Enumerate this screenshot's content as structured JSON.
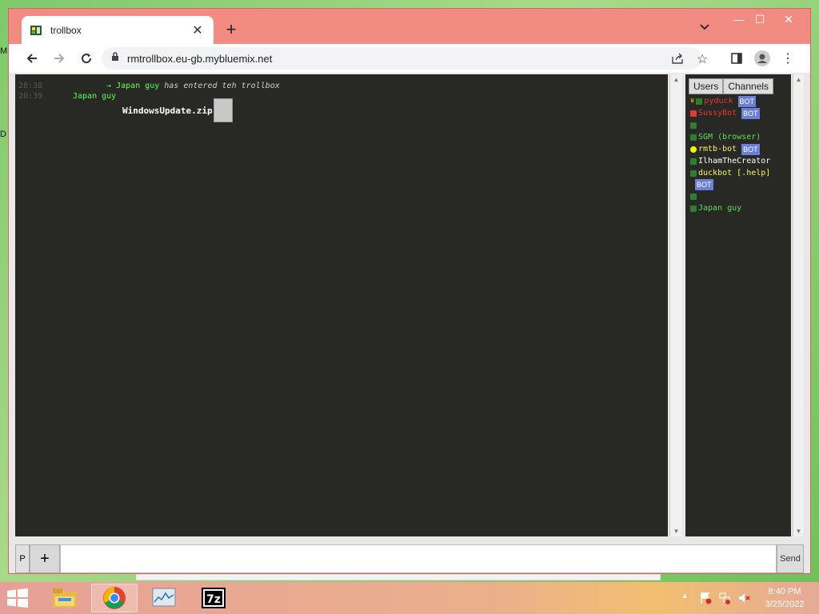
{
  "desktop": {
    "label_m": "M",
    "label_d": "D"
  },
  "browser": {
    "tab": {
      "title": "trollbox"
    },
    "address": {
      "url": "rmtrollbox.eu-gb.mybluemix.net"
    }
  },
  "chat": {
    "messages": [
      {
        "time": "20:38",
        "arrow": "→",
        "nick": "Japan guy",
        "text": "has entered teh trollbox"
      },
      {
        "time": "20:39",
        "nick": "Japan guy"
      }
    ],
    "file": {
      "name": "WindowsUpdate.zip"
    }
  },
  "users_panel": {
    "tabs": [
      "Users",
      "Channels"
    ],
    "users": [
      {
        "name": "pyduck",
        "color": "#e53935",
        "dot": "#2e7d32",
        "crown": true,
        "bot": true
      },
      {
        "name": "SussyBot",
        "color": "#e53935",
        "dot": "#e53935",
        "bot": true
      },
      {
        "name": "_____",
        "color": "#1a237e",
        "dot": "#2e7d32",
        "bot": false
      },
      {
        "name": "SGM (browser)",
        "color": "#5fdc5f",
        "dot": "#2e7d32",
        "bot": false
      },
      {
        "name": "rmtb-bot",
        "color": "#f5f55f",
        "dot": "#f5f500",
        "bot": true
      },
      {
        "name": "IlhamTheCreator",
        "color": "#ffffff",
        "dot": "#2e7d32",
        "bot": false
      },
      {
        "name": "duckbot [.help]",
        "color": "#f5f55f",
        "dot": "#2e7d32",
        "bot": true
      },
      {
        "name": "_",
        "color": "#1a237e",
        "dot": "#2e7d32",
        "bot": false
      },
      {
        "name": "Japan guy",
        "color": "#5fdc5f",
        "dot": "#2e7d32",
        "bot": false
      }
    ],
    "bot_label": "BOT"
  },
  "input_bar": {
    "p_label": "P",
    "plus_label": "+",
    "send_label": "Send",
    "message_value": ""
  },
  "taskbar": {
    "clock_time": "8:40 PM",
    "clock_date": "3/25/2022",
    "apps": [
      "file-explorer",
      "chrome",
      "task-manager",
      "7zip"
    ]
  },
  "colors": {
    "titlebar": "#f28b82",
    "chat_bg": "#282824",
    "nick_green": "#5fdc5f",
    "bot_badge": "#6a7fd8"
  }
}
